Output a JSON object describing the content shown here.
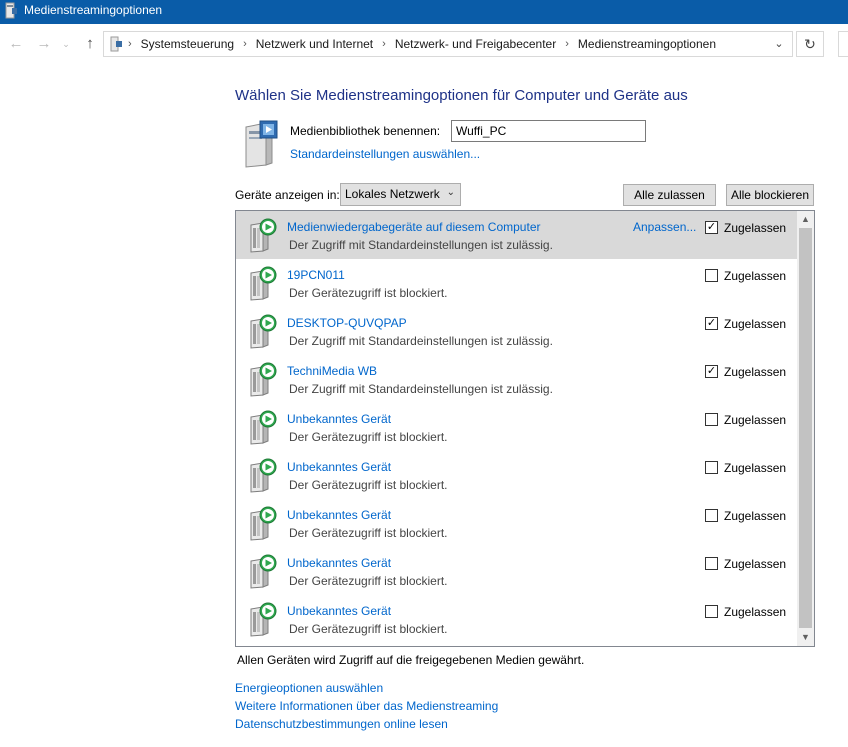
{
  "window": {
    "title": "Medienstreamingoptionen"
  },
  "nav": {
    "back_icon": "arrow-left-icon",
    "forward_icon": "arrow-right-icon",
    "recent_icon": "chevron-down-icon",
    "up_icon": "arrow-up-icon",
    "refresh_icon": "refresh-icon",
    "breadcrumbs": [
      "Systemsteuerung",
      "Netzwerk und Internet",
      "Netzwerk- und Freigabecenter",
      "Medienstreamingoptionen"
    ]
  },
  "main": {
    "heading": "Wählen Sie Medienstreamingoptionen für Computer und Geräte aus",
    "library_label": "Medienbibliothek benennen:",
    "library_value": "Wuffi_PC",
    "defaults_link": "Standardeinstellungen auswählen...",
    "show_devices_label": "Geräte anzeigen in:",
    "network_select": "Lokales Netzwerk",
    "allow_all": "Alle zulassen",
    "block_all": "Alle blockieren",
    "customize_link": "Anpassen...",
    "footer_note": "Allen Geräten wird Zugriff auf die freigegebenen Medien gewährt."
  },
  "devices": [
    {
      "name": "Medienwiedergabegeräte auf diesem Computer",
      "status": "Der Zugriff mit Standardeinstellungen ist zulässig.",
      "allowed_label": "Zugelassen",
      "checked": true,
      "selected": true
    },
    {
      "name": "19PCN011",
      "status": "Der Gerätezugriff ist blockiert.",
      "allowed_label": "Zugelassen",
      "checked": false,
      "selected": false
    },
    {
      "name": "DESKTOP-QUVQPAP",
      "status": "Der Zugriff mit Standardeinstellungen ist zulässig.",
      "allowed_label": "Zugelassen",
      "checked": true,
      "selected": false
    },
    {
      "name": "TechniMedia WB",
      "status": "Der Zugriff mit Standardeinstellungen ist zulässig.",
      "allowed_label": "Zugelassen",
      "checked": true,
      "selected": false
    },
    {
      "name": "Unbekanntes Gerät",
      "status": "Der Gerätezugriff ist blockiert.",
      "allowed_label": "Zugelassen",
      "checked": false,
      "selected": false
    },
    {
      "name": "Unbekanntes Gerät",
      "status": "Der Gerätezugriff ist blockiert.",
      "allowed_label": "Zugelassen",
      "checked": false,
      "selected": false
    },
    {
      "name": "Unbekanntes Gerät",
      "status": "Der Gerätezugriff ist blockiert.",
      "allowed_label": "Zugelassen",
      "checked": false,
      "selected": false
    },
    {
      "name": "Unbekanntes Gerät",
      "status": "Der Gerätezugriff ist blockiert.",
      "allowed_label": "Zugelassen",
      "checked": false,
      "selected": false
    },
    {
      "name": "Unbekanntes Gerät",
      "status": "Der Gerätezugriff ist blockiert.",
      "allowed_label": "Zugelassen",
      "checked": false,
      "selected": false
    }
  ],
  "links": {
    "energy": "Energieoptionen auswählen",
    "more_info": "Weitere Informationen über das Medienstreaming",
    "privacy": "Datenschutzbestimmungen online lesen"
  },
  "colors": {
    "titlebar": "#0a5ca8",
    "link": "#0066cc",
    "heading": "#1e3287",
    "selection": "#d9d9d9",
    "play_green": "#2fa84f"
  }
}
